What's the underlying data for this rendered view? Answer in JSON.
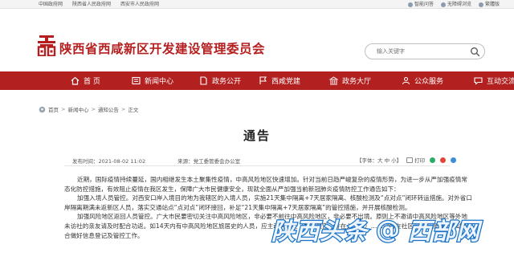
{
  "topbar": {
    "links": [
      "中国政府网",
      "陕西省人民政府网",
      "西安市人民政府网"
    ],
    "right": [
      "智能问答",
      "无障碍浏览",
      "繁體版"
    ]
  },
  "header": {
    "site_title": "陕西省西咸新区开发建设管理委员会",
    "search_placeholder": "输入关键字"
  },
  "nav": {
    "items": [
      {
        "label": "首  页",
        "icon": "home-icon"
      },
      {
        "label": "新闻中心",
        "icon": "news-icon"
      },
      {
        "label": "政务公开",
        "icon": "document-icon"
      },
      {
        "label": "西咸党建",
        "icon": "flag-icon"
      },
      {
        "label": "政务大厅",
        "icon": "hall-icon"
      },
      {
        "label": "公众服务",
        "icon": "people-icon"
      },
      {
        "label": "互动交流",
        "icon": "chat-icon"
      }
    ]
  },
  "breadcrumb": [
    "首页",
    "新闻中心",
    "通知公告",
    "正文"
  ],
  "article": {
    "title": "通告",
    "date": "发布时间：2021-08-02 11:02",
    "source": "来源：党工委管委会办公室",
    "font_size_label": "【字体：大 中 小】",
    "print_label": "打印",
    "paragraphs": [
      "近期，国际疫情持续蔓延，国内相继发生本土聚集性疫情，中高风险地区快速增加。针对当前日趋严峻复杂的疫情形势，为进一步从严加强疫情常态化防控措施，有效阻止疫情在我区发生，保障广大市民健康安全，现就全面从严加强当前新冠肺炎疫情防控工作通告如下：",
      "加强入境人员管控。对西安口岸入境目的地为我辖区的入境人员，实施21天集中隔离+7天居家隔离、核酸检测及“点对点”闭环转运措施。对外省口岸隔离期满未返新区人员，落实交通站点“点对点”闭环接回，补足“21天集中隔离+7天居家隔离”的管控措施，并开展核酸检测。",
      "加强风险地区返回人员管控。广大市民要密切关注中高风险地区，非必要不前往中高风险地区，非必要不出境。原则上不邀请中高风险地区等外地未访社的亲友请及时配合功返。如14天内有中高风险地区旅居史的人员，应主动向社区（村）报告，并在入（返）……向所在社区和单位报备，主动配合做好信息登记及管控工作。"
    ]
  },
  "watermark": {
    "left": "陕西头条",
    "at": "@",
    "right": "西部网"
  },
  "colors": {
    "brand_red": "#b22020",
    "title_red": "#b51f1f",
    "watermark_blue": "#1a73c8"
  }
}
